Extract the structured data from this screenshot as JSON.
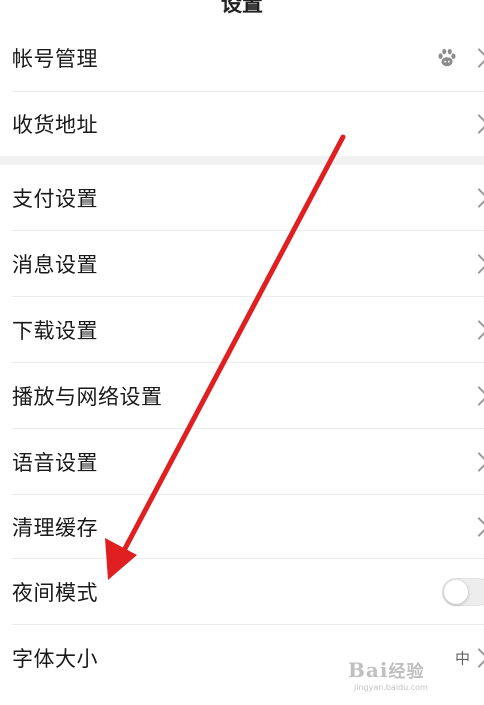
{
  "header": {
    "title": "设置"
  },
  "rows": [
    {
      "label": "帐号管理",
      "accessory": "avatar-chevron"
    },
    {
      "label": "收货地址",
      "accessory": "chevron"
    },
    {
      "label": "支付设置",
      "accessory": "chevron"
    },
    {
      "label": "消息设置",
      "accessory": "chevron"
    },
    {
      "label": "下载设置",
      "accessory": "chevron"
    },
    {
      "label": "播放与网络设置",
      "accessory": "chevron"
    },
    {
      "label": "语音设置",
      "accessory": "chevron"
    },
    {
      "label": "清理缓存",
      "accessory": "chevron"
    },
    {
      "label": "夜间模式",
      "accessory": "toggle",
      "toggle_on": false
    },
    {
      "label": "字体大小",
      "accessory": "value-chevron",
      "value": "中"
    }
  ],
  "icons": [
    "baidu-paw-avatar-icon",
    "chevron-right-icon"
  ],
  "annotation": {
    "arrow_color": "#e02020"
  },
  "watermark": {
    "text": "Bai经验",
    "subtext": "jingyan.baidu.com"
  }
}
